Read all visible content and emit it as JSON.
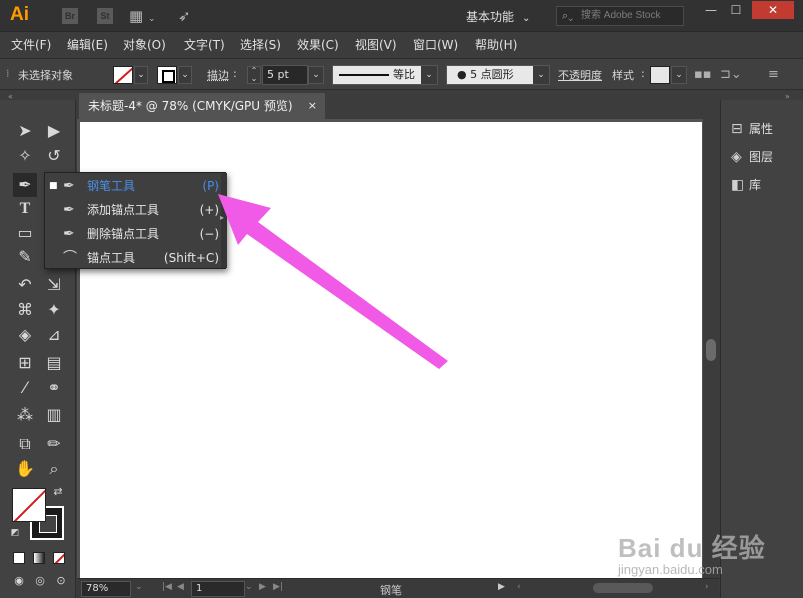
{
  "app": {
    "logo": "Ai",
    "bridge_badge": "Br",
    "stock_badge": "St",
    "workspace_label": "基本功能",
    "search_placeholder": "搜索 Adobe Stock"
  },
  "menu": {
    "items": [
      "文件(F)",
      "编辑(E)",
      "对象(O)",
      "文字(T)",
      "选择(S)",
      "效果(C)",
      "视图(V)",
      "窗口(W)",
      "帮助(H)"
    ]
  },
  "controlbar": {
    "selection_status": "未选择对象",
    "stroke_label": "描边",
    "stroke_weight": "5 pt",
    "stroke_profile": "等比",
    "brush_def": "5 点圆形",
    "opacity_label": "不透明度",
    "style_label": "样式"
  },
  "document": {
    "tab_title": "未标题-4* @ 78% (CMYK/GPU 预览)",
    "close_glyph": "×"
  },
  "statusbar": {
    "zoom": "78%",
    "artboard_number": "1",
    "current_tool": "钢笔"
  },
  "right_panel": {
    "items": [
      {
        "label": "属性",
        "icon": "properties-icon"
      },
      {
        "label": "图层",
        "icon": "layers-icon"
      },
      {
        "label": "库",
        "icon": "libraries-icon"
      }
    ]
  },
  "flyout": {
    "items": [
      {
        "label": "钢笔工具",
        "shortcut": "(P)",
        "icon": "pen-tool-icon",
        "selected": true
      },
      {
        "label": "添加锚点工具",
        "shortcut": "(+)",
        "icon": "add-anchor-point-icon",
        "selected": false
      },
      {
        "label": "删除锚点工具",
        "shortcut": "(−)",
        "icon": "delete-anchor-point-icon",
        "selected": false
      },
      {
        "label": "锚点工具",
        "shortcut": "(Shift+C)",
        "icon": "anchor-point-icon",
        "selected": false
      }
    ]
  },
  "annotation": {
    "arrow_color": "#f05ae6"
  },
  "watermark": {
    "main": "Bai du 经验",
    "sub": "jingyan.baidu.com"
  },
  "colors": {
    "accent_orange": "#ff9a00",
    "selected_blue": "#4a8fe8",
    "close_red": "#c23b30"
  }
}
